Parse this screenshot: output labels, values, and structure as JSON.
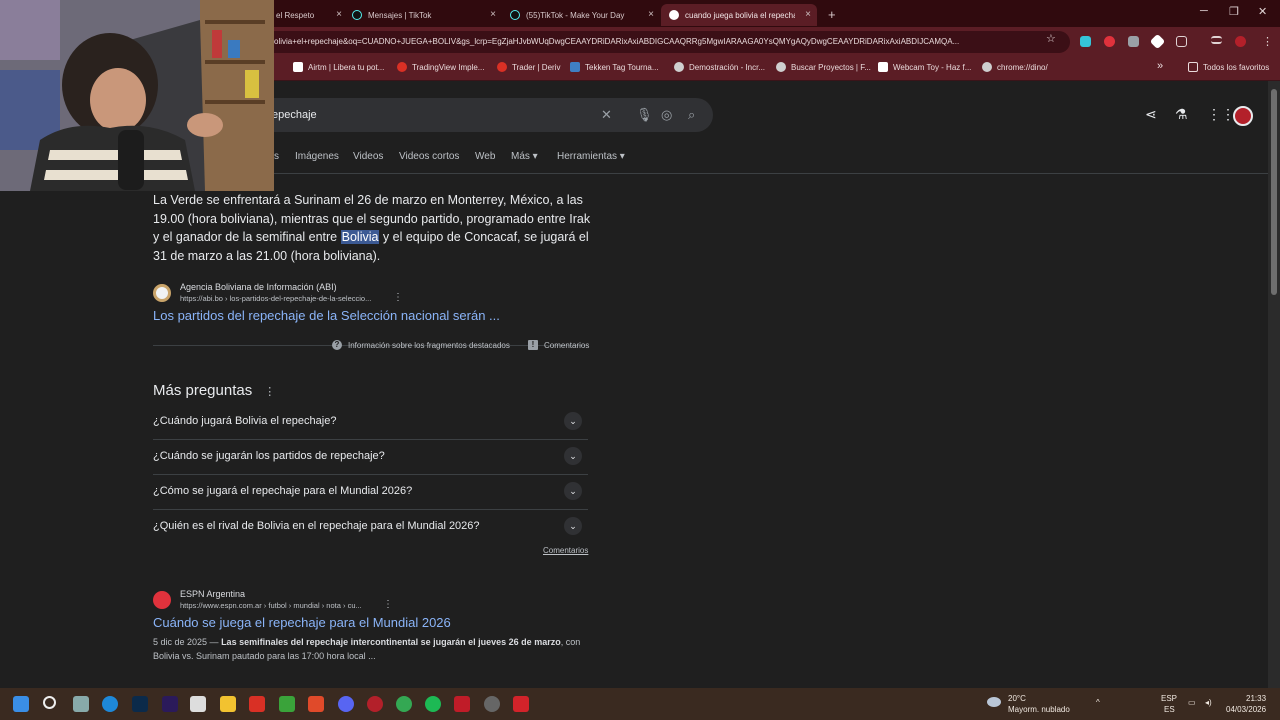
{
  "browser": {
    "tabs": [
      {
        "label": "el Respeto",
        "icon": "ad-icon"
      },
      {
        "label": "Mensajes | TikTok",
        "icon": "tiktok-icon"
      },
      {
        "label": "(55)TikTok - Make Your Day",
        "icon": "tiktok-icon"
      },
      {
        "label": "cuando juega bolivia el repecha",
        "icon": "google-icon"
      }
    ],
    "new_tab": "+",
    "url": "olivia+el+repechaje&oq=CUADNO+JUEGA+BOLIV&gs_lcrp=EgZjaHJvbWUqDwgCEAAYDRiDARixAxiABDIGCAAQRRg5MgwIARAAGA0YsQMYgAQyDwgCEAAYDRiDARixAxiABDIJCAMQA...",
    "bookmarks": [
      {
        "label": "Airtm | Libera tu pot...",
        "color": "#ffffff"
      },
      {
        "label": "TradingView Imple...",
        "color": "#d93025"
      },
      {
        "label": "Trader | Deriv",
        "color": "#d93025"
      },
      {
        "label": "Tekken Tag Tourna...",
        "color": "#3f7fc4"
      },
      {
        "label": "Demostración - Incr...",
        "color": "#cfcfcf"
      },
      {
        "label": "Buscar Proyectos | F...",
        "color": "#cfcfcf"
      },
      {
        "label": "Webcam Toy - Haz f...",
        "color": "#ffffff"
      },
      {
        "label": "chrome://dino/",
        "color": "#cfcfcf"
      }
    ],
    "all_bookmarks": "Todos los favoritos",
    "more_bookmarks": "»"
  },
  "search": {
    "query": "epechaje",
    "filters": [
      "s",
      "Imágenes",
      "Videos",
      "Videos cortos",
      "Web",
      "Más ▾",
      "Herramientas ▾"
    ]
  },
  "featured": {
    "text_before": "La Verde se enfrentará a Surinam el 26 de marzo en Monterrey, México, a las 19.00 (hora boliviana), mientras que el segundo partido, programado entre Irak y el ganador de la semifinal entre ",
    "highlight": "Bolivia",
    "text_after": " y el equipo de Concacaf, se jugará el 31 de marzo a las 21.00 (hora boliviana).",
    "source_name": "Agencia Boliviana de Información (ABI)",
    "source_url": "https://abi.bo › los-partidos-del-repechaje-de-la-seleccio...",
    "link": "Los partidos del repechaje de la Selección nacional serán ...",
    "about": "Información sobre los fragmentos destacados",
    "feedback": "Comentarios"
  },
  "paa": {
    "title": "Más preguntas",
    "questions": [
      "¿Cuándo jugará Bolivia el repechaje?",
      "¿Cuándo se jugarán los partidos de repechaje?",
      "¿Cómo se jugará el repechaje para el Mundial 2026?",
      "¿Quién es el rival de Bolivia en el repechaje para el Mundial 2026?"
    ],
    "feedback": "Comentarios"
  },
  "result2": {
    "source_name": "ESPN Argentina",
    "source_url": "https://www.espn.com.ar › futbol › mundial › nota › cu...",
    "title": "Cuándo se juega el repechaje para el Mundial 2026",
    "date": "5 dic de 2025",
    "dash": " — ",
    "snippet_bold": "Las semifinales del repechaje intercontinental se jugarán el jueves 26 de marzo",
    "snippet_rest": ", con Bolivia vs. Surinam pautado para las 17:00 hora local ..."
  },
  "taskbar": {
    "weather_temp": "20°C",
    "weather_desc": "Mayorm. nublado",
    "lang1": "ESP",
    "lang2": "ES",
    "time": "21:33",
    "date": "04/03/2026"
  },
  "colors": {
    "accent": "#8ab4f8",
    "frame": "#5b1d25",
    "background": "#1f1f1f"
  }
}
